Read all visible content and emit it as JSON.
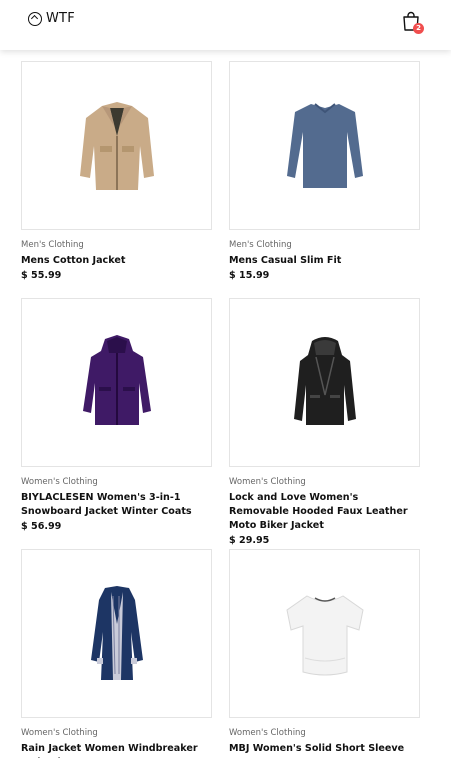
{
  "header": {
    "brand": "WTF",
    "cart_count": "2"
  },
  "products": [
    {
      "category": "Men's Clothing",
      "title": "Mens Cotton Jacket",
      "price": "$ 55.99"
    },
    {
      "category": "Men's Clothing",
      "title": "Mens Casual Slim Fit",
      "price": "$ 15.99"
    },
    {
      "category": "Women's Clothing",
      "title": "BIYLACLESEN Women's 3-in-1 Snowboard Jacket Winter Coats",
      "price": "$ 56.99"
    },
    {
      "category": "Women's Clothing",
      "title": "Lock and Love Women's Removable Hooded Faux Leather Moto Biker Jacket",
      "price": "$ 29.95"
    },
    {
      "category": "Women's Clothing",
      "title": "Rain Jacket Women Windbreaker Striped",
      "price": ""
    },
    {
      "category": "Women's Clothing",
      "title": "MBJ Women's Solid Short Sleeve Boat",
      "price": ""
    }
  ],
  "colors": {
    "badge": "#f04e4e",
    "border": "#e4e4e4"
  }
}
